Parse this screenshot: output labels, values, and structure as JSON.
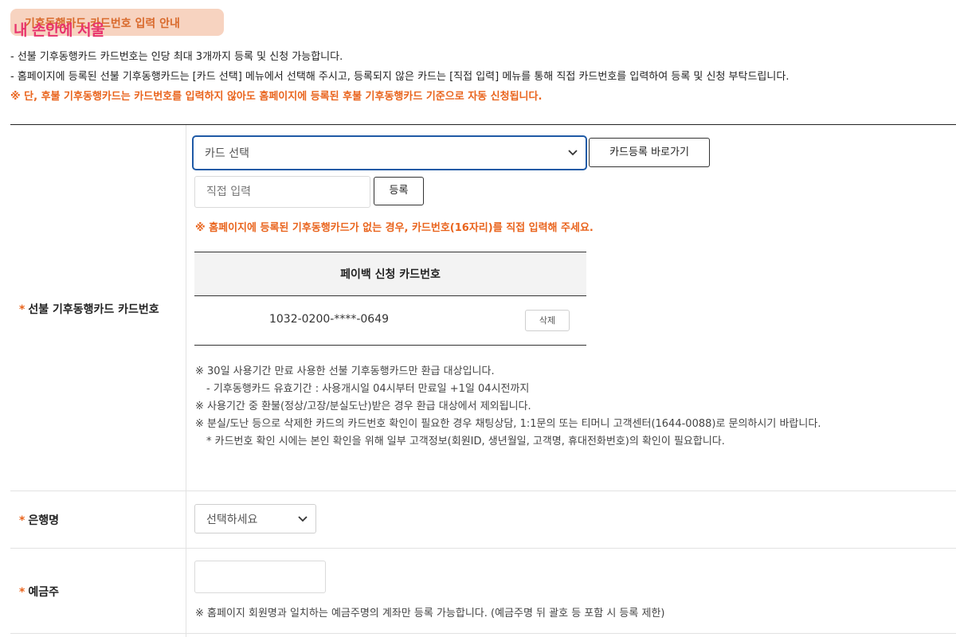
{
  "header": {
    "title": "기후동행카드 카드번호 입력 안내",
    "watermark": "내 손안에 서울"
  },
  "intro": {
    "line1": "- 선불 기후동행카드 카드번호는 인당 최대 3개까지 등록 및 신청 가능합니다.",
    "line2": "- 홈페이지에 등록된 선불 기후동행카드는 [카드 선택] 메뉴에서 선택해 주시고, 등록되지 않은 카드는 [직접 입력] 메뉴를 통해 직접 카드번호를 입력하여 등록 및 신청 부탁드립니다.",
    "warning": "※ 단, 후불 기후동행카드는 카드번호를 입력하지 않아도 홈페이지에 등록된 후불 기후동행카드 기준으로 자동 신청됩니다."
  },
  "card_field": {
    "required_mark": "*",
    "label": "선불 기후동행카드 카드번호",
    "select_value": "카드 선택",
    "shortcut_button": "카드등록 바로가기",
    "direct_input_placeholder": "직접 입력",
    "register_button": "등록",
    "warning": "※ 홈페이지에 등록된 기후동행카드가 없는 경우, 카드번호(16자리)를 직접 입력해 주세요.",
    "table_header": "페이백 신청 카드번호",
    "rows": [
      {
        "number": "1032-0200-****-0649",
        "delete_label": "삭제"
      }
    ],
    "notes": [
      "※ 30일 사용기간 만료 사용한 선불 기후동행카드만 환급 대상입니다.",
      "- 기후동행카드 유효기간 : 사용개시일 04시부터 만료일 +1일 04시전까지",
      "※ 사용기간 중 환불(정상/고장/분실도난)받은 경우 환급 대상에서 제외됩니다.",
      "※ 분실/도난 등으로 삭제한 카드의 카드번호 확인이 필요한 경우 채팅상담, 1:1문의 또는 티머니 고객센터(1644-0088)로 문의하시기 바랍니다.",
      "* 카드번호 확인 시에는 본인 확인을 위해 일부 고객정보(회원ID, 생년월일, 고객명, 휴대전화번호)의 확인이 필요합니다."
    ]
  },
  "bank_field": {
    "required_mark": "*",
    "label": "은행명",
    "select_value": "선택하세요"
  },
  "holder_field": {
    "required_mark": "*",
    "label": "예금주",
    "value": "",
    "note": "※ 홈페이지 회원명과 일치하는 예금주명의 계좌만 등록 가능합니다. (예금주명 뒤 괄호 등 포함 시 등록 제한)"
  },
  "colors": {
    "accent_orange": "#e9641d",
    "focus_blue": "#1f5aa6",
    "badge_bg": "#f7d3c0",
    "watermark_pink": "#e8336d"
  }
}
